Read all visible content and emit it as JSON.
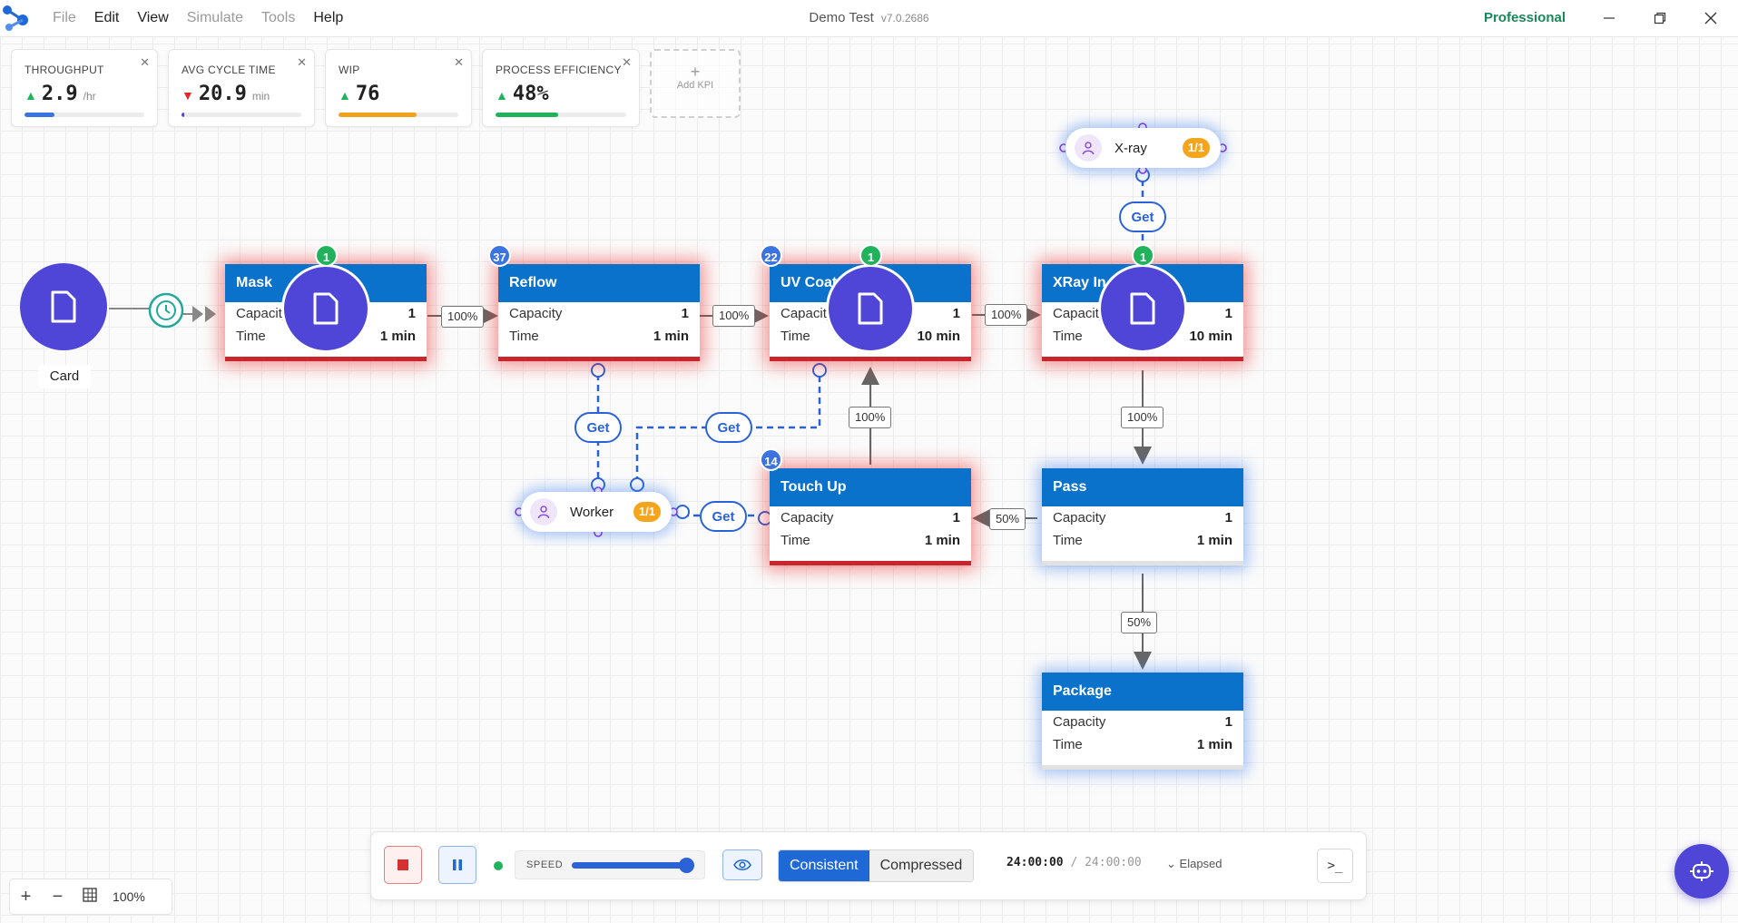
{
  "titlebar": {
    "menu": [
      {
        "label": "File",
        "enabled": false
      },
      {
        "label": "Edit",
        "enabled": true
      },
      {
        "label": "View",
        "enabled": true
      },
      {
        "label": "Simulate",
        "enabled": false
      },
      {
        "label": "Tools",
        "enabled": false
      },
      {
        "label": "Help",
        "enabled": true
      }
    ],
    "title": "Demo Test",
    "version": "v7.0.2686",
    "plan": "Professional",
    "icons": [
      "minimize-icon",
      "restore-icon",
      "close-icon"
    ]
  },
  "kpis": [
    {
      "label": "THROUGHPUT",
      "value": "2.9",
      "unit": "/hr",
      "trend": "up",
      "trend_color": "#21b35b",
      "bar_fraction": 0.25,
      "bar_color": "#3b73e0"
    },
    {
      "label": "AVG CYCLE TIME",
      "value": "20.9",
      "unit": "min",
      "trend": "down",
      "trend_color": "#e02a2a",
      "bar_fraction": 0.02,
      "bar_color": "#4f46d8"
    },
    {
      "label": "WIP",
      "value": "76",
      "unit": "",
      "trend": "up",
      "trend_color": "#21b35b",
      "bar_fraction": 0.65,
      "bar_color": "#f0a21b"
    },
    {
      "label": "PROCESS EFFICIENCY",
      "value": "48%",
      "unit": "",
      "trend": "up",
      "trend_color": "#21b35b",
      "bar_fraction": 0.48,
      "bar_color": "#21b35b"
    }
  ],
  "add_kpi": {
    "symbol": "+",
    "label": "Add KPI"
  },
  "source": {
    "label": "Card",
    "icon": "document-icon"
  },
  "processes": [
    {
      "id": "mask",
      "name": "Mask",
      "capacity_label": "Capacity",
      "capacity": "1",
      "time_label": "Time",
      "time": "1 min",
      "badge": "1",
      "badge_color": "green",
      "state": "red"
    },
    {
      "id": "reflow",
      "name": "Reflow",
      "capacity_label": "Capacity",
      "capacity": "1",
      "time_label": "Time",
      "time": "1 min",
      "badge": "37",
      "badge_color": "blue",
      "state": "red"
    },
    {
      "id": "uvcoat",
      "name": "UV Coat",
      "capacity_label": "Capacity",
      "capacity": "1",
      "time_label": "Time",
      "time": "10 min",
      "badge": "22",
      "badge_color": "blue",
      "state": "red"
    },
    {
      "id": "xray",
      "name": "XRay In",
      "capacity_label": "Capacity",
      "capacity": "1",
      "time_label": "Time",
      "time": "10 min",
      "badge": "1",
      "badge_color": "green",
      "state": "red"
    },
    {
      "id": "touchup",
      "name": "Touch Up",
      "capacity_label": "Capacity",
      "capacity": "1",
      "time_label": "Time",
      "time": "1 min",
      "badge": "14",
      "badge_color": "blue",
      "state": "red"
    },
    {
      "id": "pass",
      "name": "Pass",
      "capacity_label": "Capacity",
      "capacity": "1",
      "time_label": "Time",
      "time": "1 min",
      "badge": "",
      "badge_color": "",
      "state": "blue"
    },
    {
      "id": "package",
      "name": "Package",
      "capacity_label": "Capacity",
      "capacity": "1",
      "time_label": "Time",
      "time": "1 min",
      "badge": "",
      "badge_color": "",
      "state": "blue"
    }
  ],
  "badges_extra": {
    "uvcoat_top": "1"
  },
  "routes": {
    "mask_reflow": "100%",
    "reflow_uvcoat": "100%",
    "uvcoat_xray": "100%",
    "touchup_uvcoat": "100%",
    "xray_pass": "100%",
    "pass_touchup": "50%",
    "pass_package": "50%"
  },
  "resources": [
    {
      "id": "xray",
      "label": "X-ray",
      "count": "1/1",
      "icon": "person-icon"
    },
    {
      "id": "worker",
      "label": "Worker",
      "count": "1/1",
      "icon": "person-icon"
    }
  ],
  "get_label": "Get",
  "controls": {
    "zoom": "100%",
    "speed_label": "SPEED",
    "speed_fraction": 0.95,
    "modes": [
      "Consistent",
      "Compressed"
    ],
    "active_mode": "Consistent",
    "time_current": "24:00:00",
    "time_separator": "/",
    "time_total": "24:00:00",
    "time_mode": "Elapsed",
    "console_symbol": ">_",
    "running": true
  }
}
